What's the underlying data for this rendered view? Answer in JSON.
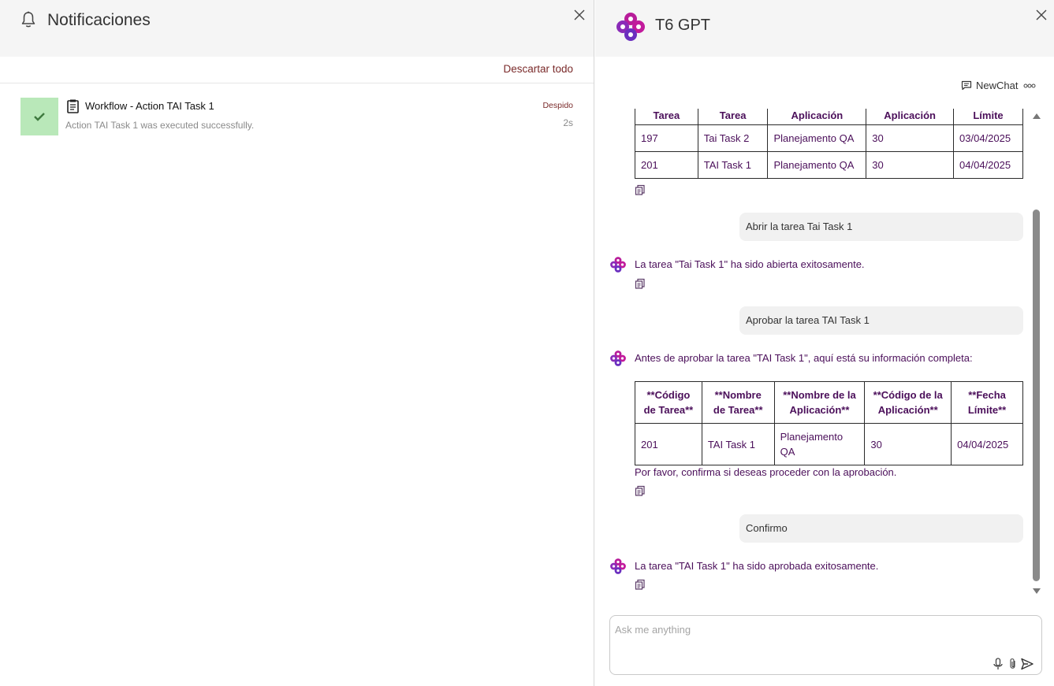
{
  "notifications": {
    "title": "Notificaciones",
    "dismiss_all_label": "Descartar todo",
    "items": [
      {
        "name": "Workflow - Action TAI Task 1",
        "description": "Action TAI Task 1 was executed successfully.",
        "state": "Despido",
        "age": "2s",
        "status_color": "#b9e8b9"
      }
    ]
  },
  "chat": {
    "title": "T6 GPT",
    "new_chat_label": "NewChat",
    "input_placeholder": "Ask me anything",
    "input_value": "",
    "table1": {
      "headers": [
        "Tarea",
        "Tarea",
        "Aplicación",
        "Aplicación",
        "Límite"
      ],
      "rows": [
        [
          "197",
          "Tai Task 2",
          "Planejamento QA",
          "30",
          "03/04/2025"
        ],
        [
          "201",
          "TAI Task 1",
          "Planejamento QA",
          "30",
          "04/04/2025"
        ]
      ]
    },
    "user_msg_1": "Abrir la tarea Tai Task 1",
    "bot_msg_1": "La tarea \"Tai Task 1\" ha sido abierta exitosamente.",
    "user_msg_2": "Aprobar la tarea TAI Task 1",
    "bot_msg_2": "Antes de aprobar la tarea \"TAI Task 1\", aquí está su información completa:",
    "table2": {
      "headers": [
        [
          "**Código",
          "de Tarea**"
        ],
        [
          "**Nombre",
          "de Tarea**"
        ],
        [
          "**Nombre de la",
          "Aplicación**"
        ],
        [
          "**Código de la",
          "Aplicación**"
        ],
        [
          "**Fecha",
          "Límite**"
        ]
      ],
      "row": [
        "201",
        "TAI Task 1",
        "Planejamento QA",
        "30",
        "04/04/2025"
      ]
    },
    "bot_msg_2_followup": "Por favor, confirma si deseas proceder con la aprobación.",
    "user_msg_3": "Confirmo",
    "bot_msg_3": "La tarea \"TAI Task 1\" ha sido aprobada exitosamente."
  },
  "colors": {
    "bot_text": "#4b0f5a",
    "accent_link": "#7a2a2a",
    "logo_magenta": "#c21a9c",
    "logo_purple": "#6b2fbf"
  },
  "icons": [
    "bell-icon",
    "close-icon",
    "check-icon",
    "document-icon",
    "t6-logo-icon",
    "chat-bubble-icon",
    "more-dots-icon",
    "copy-icon",
    "microphone-icon",
    "paperclip-icon",
    "send-icon"
  ]
}
